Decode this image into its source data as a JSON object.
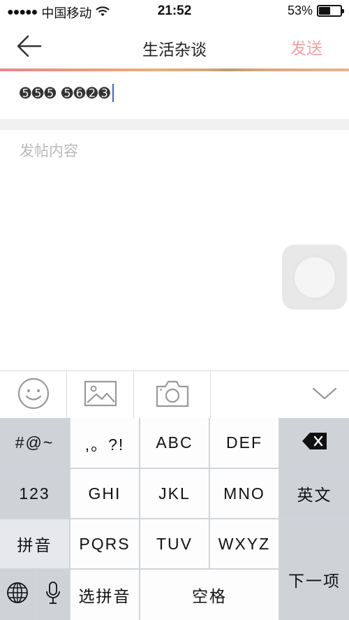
{
  "status": {
    "signal_dots": "●●●●●",
    "carrier": "中国移动",
    "time": "21:52",
    "battery_percent": "53%",
    "battery_level": 0.53
  },
  "nav": {
    "back_icon": "left-arrow-icon",
    "title": "生活杂谈",
    "send_label": "发送"
  },
  "post": {
    "title_value": "➎➎➎ ➎➏➋➌",
    "content_placeholder": "发帖内容"
  },
  "toolbar": {
    "items": [
      "smiley-icon",
      "image-icon",
      "camera-icon",
      "chevron-down-icon"
    ]
  },
  "keyboard": {
    "row1": [
      "#@~",
      ",。?!",
      "ABC",
      "DEF"
    ],
    "row2": [
      "123",
      "GHI",
      "JKL",
      "MNO",
      "英文"
    ],
    "row3": [
      "拼音",
      "PQRS",
      "TUV",
      "WXYZ"
    ],
    "row4": [
      "选拼音",
      "空格"
    ],
    "next_label": "下一项",
    "delete_icon": "backspace-icon",
    "globe_icon": "globe-icon",
    "mic_icon": "microphone-icon"
  },
  "colors": {
    "accent_send": "#f2a0a6",
    "caret": "#3a63d6"
  }
}
